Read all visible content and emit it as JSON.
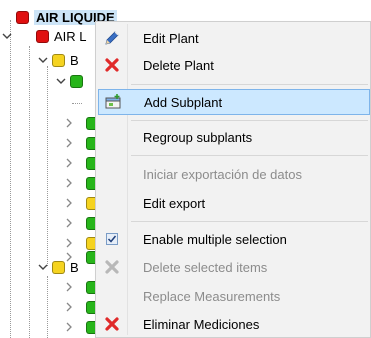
{
  "tree": {
    "root": {
      "label": "AIR LIQUIDE",
      "color": "#e01010"
    },
    "child": {
      "label": "AIR L",
      "color": "#e01010"
    },
    "group1": {
      "label": "B",
      "color": "#f5d320"
    },
    "group2": {
      "label": "B",
      "color": "#f5d320"
    },
    "green": "#27b51a",
    "yellow": "#f5d320",
    "red": "#e01010"
  },
  "menu": {
    "items": [
      {
        "label": "Edit Plant",
        "icon": "pencil-icon",
        "enabled": true
      },
      {
        "label": "Delete Plant",
        "icon": "red-x-icon",
        "enabled": true
      },
      {
        "label": "Add Subplant",
        "icon": "add-subplant-icon",
        "enabled": true,
        "highlighted": true
      },
      {
        "label": "Regroup subplants",
        "icon": "",
        "enabled": true
      },
      {
        "label": "Iniciar exportación de datos",
        "icon": "",
        "enabled": false
      },
      {
        "label": "Edit export",
        "icon": "",
        "enabled": true
      },
      {
        "label": "Enable multiple selection",
        "icon": "checkbox-icon",
        "enabled": true,
        "checked": true
      },
      {
        "label": "Delete selected items",
        "icon": "grey-x-icon",
        "enabled": false
      },
      {
        "label": "Replace Measurements",
        "icon": "",
        "enabled": false
      },
      {
        "label": "Eliminar Mediciones",
        "icon": "red-x-icon",
        "enabled": true
      }
    ],
    "highlight_bg": "#cce8ff",
    "highlight_border": "#7eb4ea"
  }
}
